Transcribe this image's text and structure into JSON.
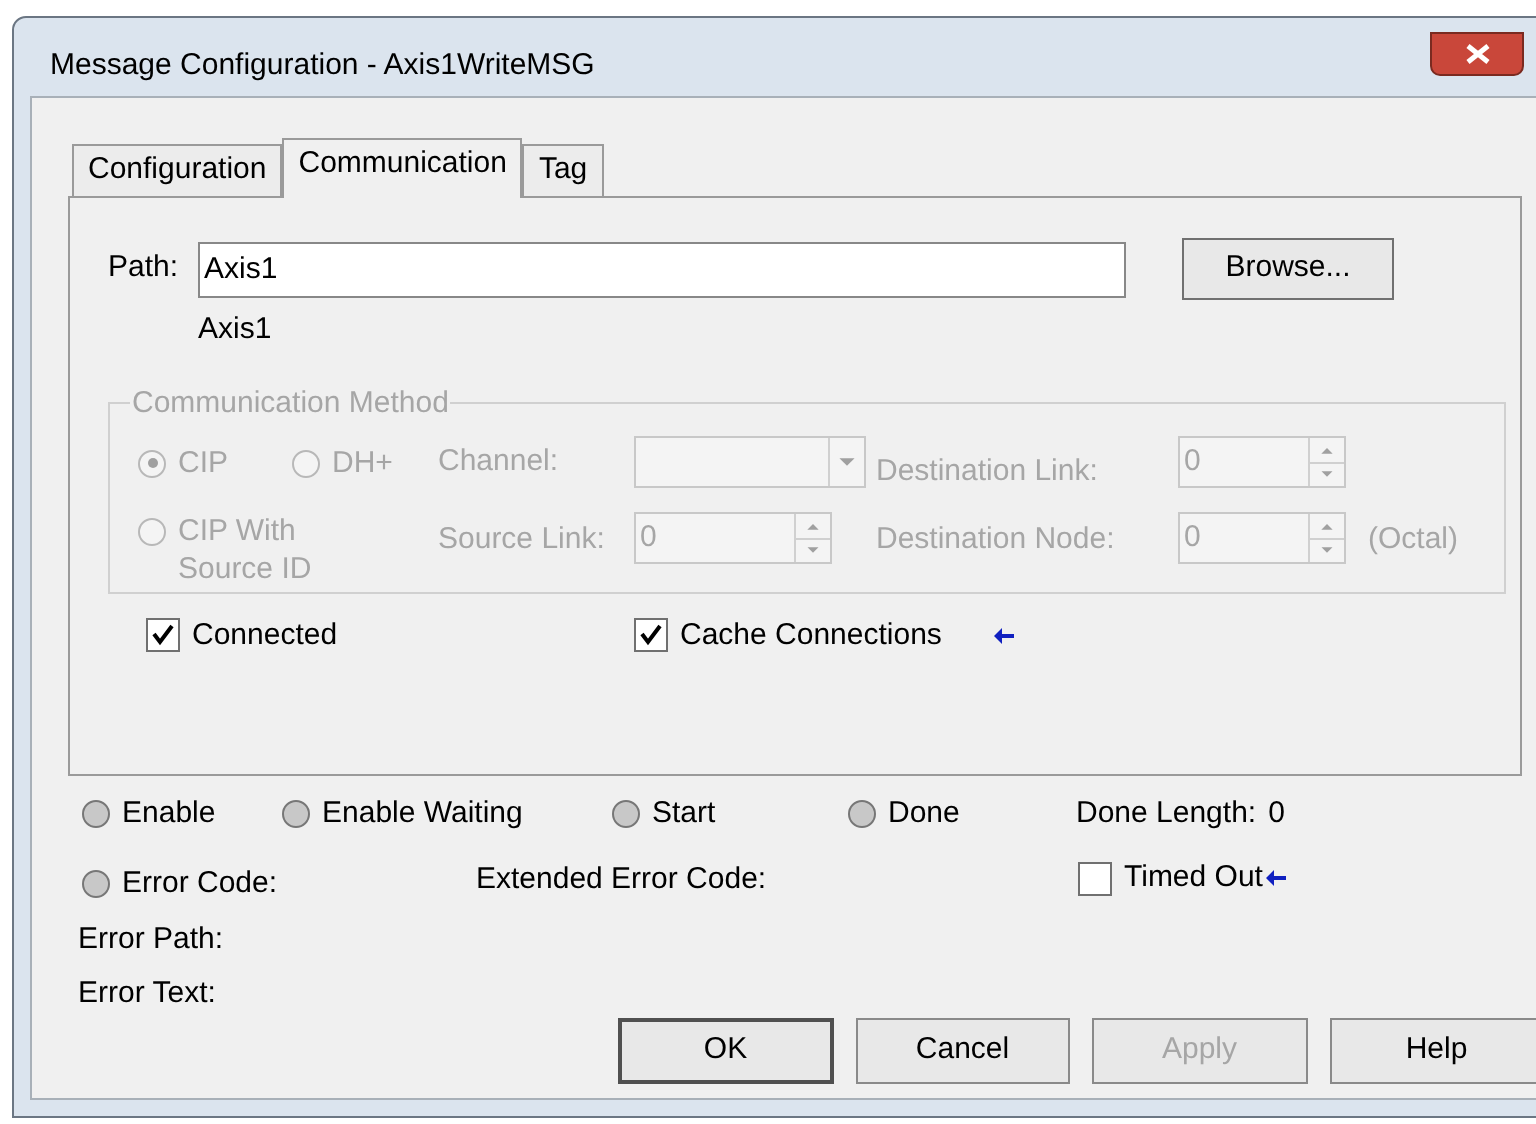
{
  "window": {
    "title": "Message Configuration - Axis1WriteMSG"
  },
  "tabs": [
    {
      "label": "Configuration",
      "selected": false
    },
    {
      "label": "Communication",
      "selected": true
    },
    {
      "label": "Tag",
      "selected": false
    }
  ],
  "path": {
    "label": "Path:",
    "value": "Axis1",
    "resolved": "Axis1",
    "browse": "Browse..."
  },
  "communication_method": {
    "title": "Communication Method",
    "disabled": true,
    "radios": [
      {
        "label": "CIP",
        "selected": true
      },
      {
        "label": "DH+",
        "selected": false
      },
      {
        "label": "CIP With Source ID",
        "selected": false
      }
    ],
    "channel": {
      "label": "Channel:"
    },
    "destination_link": {
      "label": "Destination Link:",
      "value": "0"
    },
    "source_link": {
      "label": "Source Link:",
      "value": "0"
    },
    "destination_node": {
      "label": "Destination Node:",
      "value": "0",
      "unit": "(Octal)"
    }
  },
  "options": [
    {
      "label": "Connected",
      "checked": true,
      "flagged": false
    },
    {
      "label": "Cache Connections",
      "checked": true,
      "flagged": true
    }
  ],
  "status": {
    "indicators": [
      {
        "label": "Enable",
        "on": false
      },
      {
        "label": "Enable Waiting",
        "on": false
      },
      {
        "label": "Start",
        "on": false
      },
      {
        "label": "Done",
        "on": false
      }
    ],
    "done_length": {
      "label": "Done Length:",
      "value": "0"
    },
    "error_code": {
      "label": "Error Code:",
      "on": false
    },
    "extended_error_code": {
      "label": "Extended Error Code:"
    },
    "timed_out": {
      "label": "Timed Out",
      "checked": false,
      "flagged": true
    },
    "error_path": {
      "label": "Error Path:"
    },
    "error_text": {
      "label": "Error Text:"
    }
  },
  "buttons": [
    {
      "label": "OK",
      "default": true,
      "disabled": false
    },
    {
      "label": "Cancel",
      "default": false,
      "disabled": false
    },
    {
      "label": "Apply",
      "default": false,
      "disabled": true
    },
    {
      "label": "Help",
      "default": false,
      "disabled": false
    }
  ]
}
